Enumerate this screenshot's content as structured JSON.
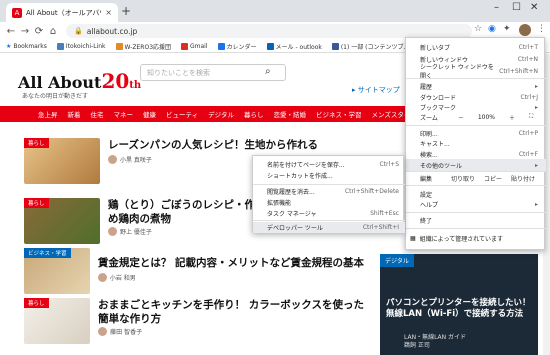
{
  "tab": {
    "title": "All About（オールアバウト）",
    "close": "×"
  },
  "newtab": "+",
  "window": {
    "min": "–",
    "max": "☐",
    "close": "✕"
  },
  "toolbar": {
    "back": "←",
    "forward": "→",
    "reload": "⟳",
    "home": "⌂",
    "url": "allabout.co.jp",
    "star": "☆",
    "more": "⋮"
  },
  "bookmarks": {
    "label": "Bookmarks",
    "items": [
      {
        "label": "Itokoichi-Link",
        "color": "#4a7ebb"
      },
      {
        "label": "W-ZERO3応援団",
        "color": "#e08a2b"
      },
      {
        "label": "Gmail",
        "color": "#d93025"
      },
      {
        "label": "カレンダー",
        "color": "#1a73e8"
      },
      {
        "label": "メール - outlook",
        "color": "#0364b8"
      },
      {
        "label": "(1) 一部 (コンテンツブ...",
        "color": "#3b5998"
      }
    ]
  },
  "site": {
    "logo_main": "All About",
    "logo_num": "20",
    "logo_th": "th",
    "tagline": "あなたの明日が動きだす",
    "search_placeholder": "知りたいことを検索",
    "sitemap": "サイトマップ",
    "categories": [
      "急上昇",
      "新着",
      "住宅",
      "マネー",
      "健康",
      "ビューティ",
      "デジタル",
      "暮らし",
      "恋愛・結婚",
      "ビジネス・学習",
      "メンズスタイル",
      "旅行",
      "趣味"
    ]
  },
  "articles": [
    {
      "tag": "暮らし",
      "title": "レーズンパンの人気レシピ！生地から作れる",
      "author": "小黒 真咲子"
    },
    {
      "tag": "暮らし",
      "title": "鶏（とり）ごぼうのレシピ・作り方…",
      "title2": "め鶏肉の煮物",
      "author": "野上 優佳子"
    },
    {
      "tag": "ビジネス・学習",
      "title": "賃金規定とは？ 記載内容・メリットなど賃金規程の基本",
      "author": "小岩 和男"
    },
    {
      "tag": "暮らし",
      "title": "おままごとキッチンを手作り！ カラーボックスを使った",
      "title2": "簡単な作り方",
      "author": "藤田 智香子"
    }
  ],
  "sidecard": {
    "label": "デジタル",
    "title": "パソコンとプリンターを接続したい！無線LAN（Wi-Fi）で接続する方法",
    "byline1": "LAN・無線LAN ガイド",
    "byline2": "鵜飼 正司"
  },
  "menu": {
    "items": [
      {
        "label": "新しいタブ",
        "key": "Ctrl+T"
      },
      {
        "label": "新しいウィンドウ",
        "key": "Ctrl+N"
      },
      {
        "label": "シークレット ウィンドウを開く",
        "key": "Ctrl+Shift+N"
      },
      {
        "label": "履歴",
        "key": "▸"
      },
      {
        "label": "ダウンロード",
        "key": "Ctrl+J"
      },
      {
        "label": "ブックマーク",
        "key": "▸"
      },
      {
        "label": "印刷...",
        "key": "Ctrl+P"
      },
      {
        "label": "キャスト...",
        "key": ""
      },
      {
        "label": "検索...",
        "key": "Ctrl+F"
      },
      {
        "label": "その他のツール",
        "key": "▸"
      },
      {
        "label": "設定",
        "key": ""
      },
      {
        "label": "ヘルプ",
        "key": "▸"
      },
      {
        "label": "終了",
        "key": ""
      },
      {
        "label": "組織によって管理されています",
        "key": ""
      }
    ],
    "zoom_label": "ズーム",
    "zoom_minus": "－",
    "zoom_value": "100%",
    "zoom_plus": "＋",
    "zoom_full": "⛶",
    "edit_label": "編集",
    "cut": "切り取り",
    "copy": "コピー",
    "paste": "貼り付け"
  },
  "submenu": {
    "items": [
      {
        "label": "名前を付けてページを保存...",
        "key": "Ctrl+S"
      },
      {
        "label": "ショートカットを作成...",
        "key": ""
      },
      {
        "label": "閲覧履歴を消去...",
        "key": "Ctrl+Shift+Delete"
      },
      {
        "label": "拡張機能",
        "key": ""
      },
      {
        "label": "タスク マネージャ",
        "key": "Shift+Esc"
      },
      {
        "label": "デベロッパー ツール",
        "key": "Ctrl+Shift+I"
      }
    ]
  }
}
